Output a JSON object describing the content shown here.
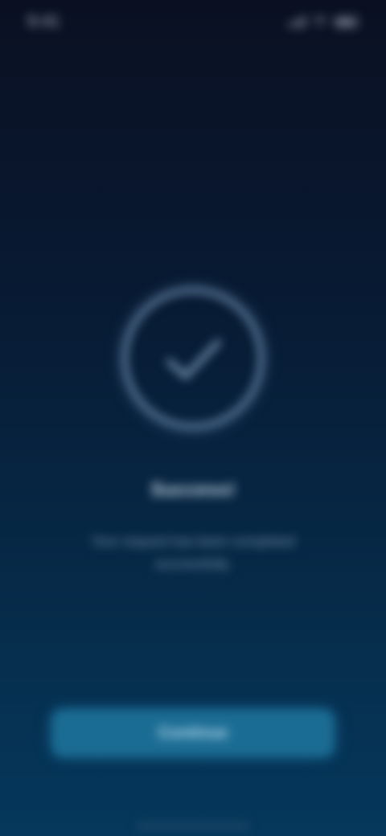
{
  "status_bar": {
    "time": "9:41",
    "icons": [
      "signal-icon",
      "wifi-icon",
      "battery-icon"
    ]
  },
  "success": {
    "icon": "checkmark-circle-icon",
    "title": "Success!",
    "message": "Your request has been completed successfully."
  },
  "actions": {
    "primary_label": "Continue"
  },
  "colors": {
    "background_top": "#0a1022",
    "background_bottom": "#05385c",
    "ring": "#5f7e9e",
    "button": "#1b6c94"
  }
}
